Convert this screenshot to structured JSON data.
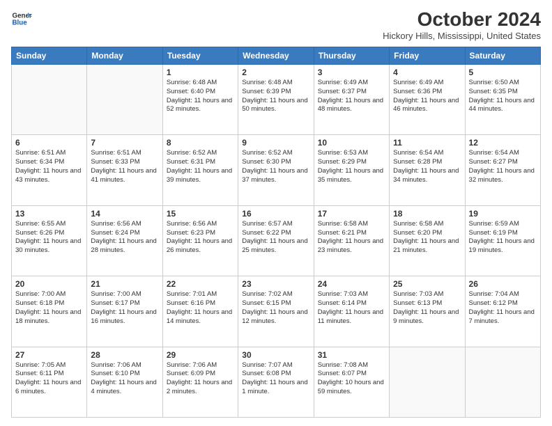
{
  "logo": {
    "line1": "General",
    "line2": "Blue"
  },
  "title": "October 2024",
  "location": "Hickory Hills, Mississippi, United States",
  "weekdays": [
    "Sunday",
    "Monday",
    "Tuesday",
    "Wednesday",
    "Thursday",
    "Friday",
    "Saturday"
  ],
  "weeks": [
    [
      {
        "day": "",
        "sunrise": "",
        "sunset": "",
        "daylight": "",
        "empty": true
      },
      {
        "day": "",
        "sunrise": "",
        "sunset": "",
        "daylight": "",
        "empty": true
      },
      {
        "day": "1",
        "sunrise": "Sunrise: 6:48 AM",
        "sunset": "Sunset: 6:40 PM",
        "daylight": "Daylight: 11 hours and 52 minutes."
      },
      {
        "day": "2",
        "sunrise": "Sunrise: 6:48 AM",
        "sunset": "Sunset: 6:39 PM",
        "daylight": "Daylight: 11 hours and 50 minutes."
      },
      {
        "day": "3",
        "sunrise": "Sunrise: 6:49 AM",
        "sunset": "Sunset: 6:37 PM",
        "daylight": "Daylight: 11 hours and 48 minutes."
      },
      {
        "day": "4",
        "sunrise": "Sunrise: 6:49 AM",
        "sunset": "Sunset: 6:36 PM",
        "daylight": "Daylight: 11 hours and 46 minutes."
      },
      {
        "day": "5",
        "sunrise": "Sunrise: 6:50 AM",
        "sunset": "Sunset: 6:35 PM",
        "daylight": "Daylight: 11 hours and 44 minutes."
      }
    ],
    [
      {
        "day": "6",
        "sunrise": "Sunrise: 6:51 AM",
        "sunset": "Sunset: 6:34 PM",
        "daylight": "Daylight: 11 hours and 43 minutes."
      },
      {
        "day": "7",
        "sunrise": "Sunrise: 6:51 AM",
        "sunset": "Sunset: 6:33 PM",
        "daylight": "Daylight: 11 hours and 41 minutes."
      },
      {
        "day": "8",
        "sunrise": "Sunrise: 6:52 AM",
        "sunset": "Sunset: 6:31 PM",
        "daylight": "Daylight: 11 hours and 39 minutes."
      },
      {
        "day": "9",
        "sunrise": "Sunrise: 6:52 AM",
        "sunset": "Sunset: 6:30 PM",
        "daylight": "Daylight: 11 hours and 37 minutes."
      },
      {
        "day": "10",
        "sunrise": "Sunrise: 6:53 AM",
        "sunset": "Sunset: 6:29 PM",
        "daylight": "Daylight: 11 hours and 35 minutes."
      },
      {
        "day": "11",
        "sunrise": "Sunrise: 6:54 AM",
        "sunset": "Sunset: 6:28 PM",
        "daylight": "Daylight: 11 hours and 34 minutes."
      },
      {
        "day": "12",
        "sunrise": "Sunrise: 6:54 AM",
        "sunset": "Sunset: 6:27 PM",
        "daylight": "Daylight: 11 hours and 32 minutes."
      }
    ],
    [
      {
        "day": "13",
        "sunrise": "Sunrise: 6:55 AM",
        "sunset": "Sunset: 6:26 PM",
        "daylight": "Daylight: 11 hours and 30 minutes."
      },
      {
        "day": "14",
        "sunrise": "Sunrise: 6:56 AM",
        "sunset": "Sunset: 6:24 PM",
        "daylight": "Daylight: 11 hours and 28 minutes."
      },
      {
        "day": "15",
        "sunrise": "Sunrise: 6:56 AM",
        "sunset": "Sunset: 6:23 PM",
        "daylight": "Daylight: 11 hours and 26 minutes."
      },
      {
        "day": "16",
        "sunrise": "Sunrise: 6:57 AM",
        "sunset": "Sunset: 6:22 PM",
        "daylight": "Daylight: 11 hours and 25 minutes."
      },
      {
        "day": "17",
        "sunrise": "Sunrise: 6:58 AM",
        "sunset": "Sunset: 6:21 PM",
        "daylight": "Daylight: 11 hours and 23 minutes."
      },
      {
        "day": "18",
        "sunrise": "Sunrise: 6:58 AM",
        "sunset": "Sunset: 6:20 PM",
        "daylight": "Daylight: 11 hours and 21 minutes."
      },
      {
        "day": "19",
        "sunrise": "Sunrise: 6:59 AM",
        "sunset": "Sunset: 6:19 PM",
        "daylight": "Daylight: 11 hours and 19 minutes."
      }
    ],
    [
      {
        "day": "20",
        "sunrise": "Sunrise: 7:00 AM",
        "sunset": "Sunset: 6:18 PM",
        "daylight": "Daylight: 11 hours and 18 minutes."
      },
      {
        "day": "21",
        "sunrise": "Sunrise: 7:00 AM",
        "sunset": "Sunset: 6:17 PM",
        "daylight": "Daylight: 11 hours and 16 minutes."
      },
      {
        "day": "22",
        "sunrise": "Sunrise: 7:01 AM",
        "sunset": "Sunset: 6:16 PM",
        "daylight": "Daylight: 11 hours and 14 minutes."
      },
      {
        "day": "23",
        "sunrise": "Sunrise: 7:02 AM",
        "sunset": "Sunset: 6:15 PM",
        "daylight": "Daylight: 11 hours and 12 minutes."
      },
      {
        "day": "24",
        "sunrise": "Sunrise: 7:03 AM",
        "sunset": "Sunset: 6:14 PM",
        "daylight": "Daylight: 11 hours and 11 minutes."
      },
      {
        "day": "25",
        "sunrise": "Sunrise: 7:03 AM",
        "sunset": "Sunset: 6:13 PM",
        "daylight": "Daylight: 11 hours and 9 minutes."
      },
      {
        "day": "26",
        "sunrise": "Sunrise: 7:04 AM",
        "sunset": "Sunset: 6:12 PM",
        "daylight": "Daylight: 11 hours and 7 minutes."
      }
    ],
    [
      {
        "day": "27",
        "sunrise": "Sunrise: 7:05 AM",
        "sunset": "Sunset: 6:11 PM",
        "daylight": "Daylight: 11 hours and 6 minutes."
      },
      {
        "day": "28",
        "sunrise": "Sunrise: 7:06 AM",
        "sunset": "Sunset: 6:10 PM",
        "daylight": "Daylight: 11 hours and 4 minutes."
      },
      {
        "day": "29",
        "sunrise": "Sunrise: 7:06 AM",
        "sunset": "Sunset: 6:09 PM",
        "daylight": "Daylight: 11 hours and 2 minutes."
      },
      {
        "day": "30",
        "sunrise": "Sunrise: 7:07 AM",
        "sunset": "Sunset: 6:08 PM",
        "daylight": "Daylight: 11 hours and 1 minute."
      },
      {
        "day": "31",
        "sunrise": "Sunrise: 7:08 AM",
        "sunset": "Sunset: 6:07 PM",
        "daylight": "Daylight: 10 hours and 59 minutes."
      },
      {
        "day": "",
        "sunrise": "",
        "sunset": "",
        "daylight": "",
        "empty": true
      },
      {
        "day": "",
        "sunrise": "",
        "sunset": "",
        "daylight": "",
        "empty": true
      }
    ]
  ]
}
